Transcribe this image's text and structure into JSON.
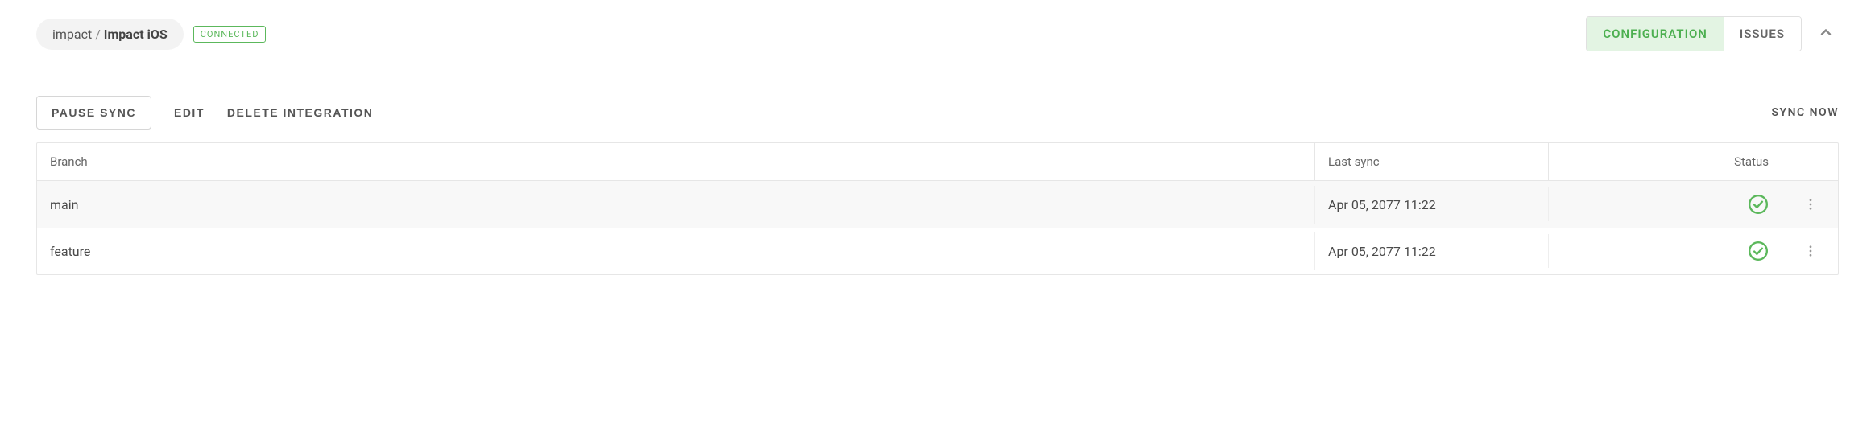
{
  "breadcrumb": {
    "org": "impact",
    "project": "Impact iOS"
  },
  "badge": {
    "label": "CONNECTED"
  },
  "tabs": {
    "configuration": "CONFIGURATION",
    "issues": "ISSUES"
  },
  "actions": {
    "pause": "PAUSE SYNC",
    "edit": "EDIT",
    "delete": "DELETE INTEGRATION",
    "sync_now": "SYNC NOW"
  },
  "table": {
    "headers": {
      "branch": "Branch",
      "last_sync": "Last sync",
      "status": "Status"
    },
    "rows": [
      {
        "branch": "main",
        "last_sync": "Apr 05, 2077 11:22"
      },
      {
        "branch": "feature",
        "last_sync": "Apr 05, 2077 11:22"
      }
    ]
  },
  "colors": {
    "green": "#5cb85c"
  }
}
